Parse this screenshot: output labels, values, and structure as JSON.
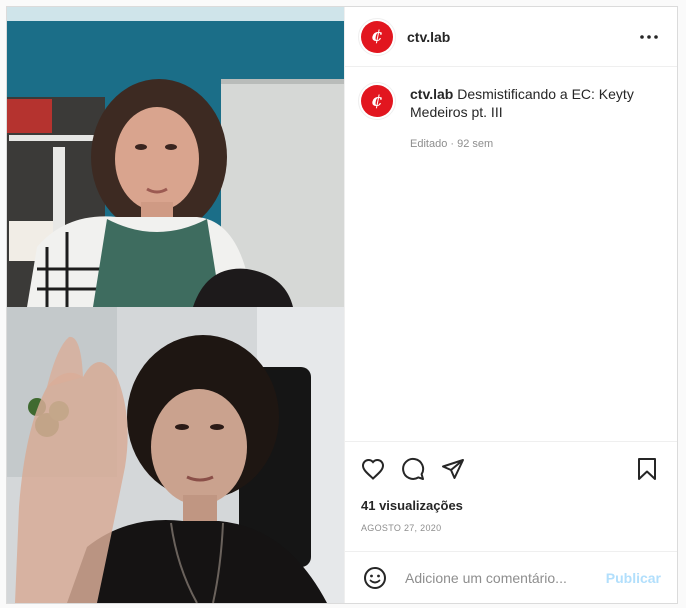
{
  "post": {
    "username": "ctv.lab",
    "avatar_letter": "¢",
    "caption_username": "ctv.lab",
    "caption": "Desmistificando a EC: Keyty Medeiros pt. III",
    "caption_meta": "Editado · 92 sem",
    "views": "41 visualizações",
    "date": "AGOSTO 27, 2020",
    "comment_placeholder": "Adicione um comentário...",
    "publish_label": "Publicar"
  },
  "icons": {
    "more": "more-options-icon",
    "like": "heart-icon",
    "comment": "comment-icon",
    "share": "paper-plane-icon",
    "save": "bookmark-icon",
    "emoji": "emoji-icon"
  },
  "colors": {
    "brand": "#e2161f",
    "publish_disabled": "#b2dffc",
    "meta": "#8e8e8e"
  }
}
